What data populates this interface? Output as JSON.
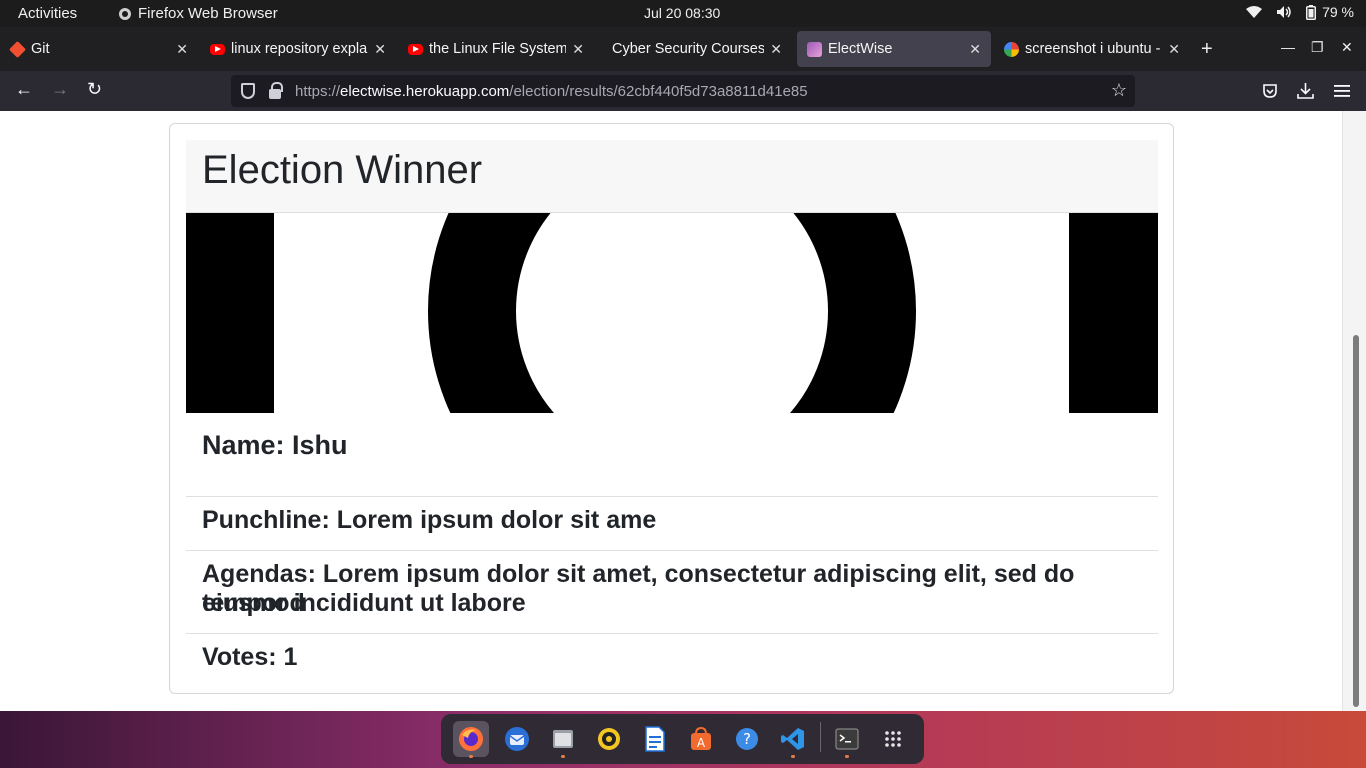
{
  "topbar": {
    "activities": "Activities",
    "app_name": "Firefox Web Browser",
    "clock": "Jul 20  08:30",
    "battery": "79 %"
  },
  "tabs": [
    {
      "title": "Git",
      "icon": "git-icon"
    },
    {
      "title": "linux repository expla",
      "icon": "youtube-icon"
    },
    {
      "title": "the Linux File System",
      "icon": "youtube-icon"
    },
    {
      "title": "Cyber Security Courses :",
      "icon": "none"
    },
    {
      "title": "ElectWise",
      "icon": "electwise-icon",
      "active": true
    },
    {
      "title": "screenshot i ubuntu -",
      "icon": "google-icon"
    }
  ],
  "navbar": {
    "url_prefix": "https://",
    "url_host": "electwise.herokuapp.com",
    "url_path": "/election/results/62cbf440f5d73a8811d41e85"
  },
  "page": {
    "title": "Election Winner",
    "name": "Name: Ishu",
    "punchline": "Punchline: Lorem ipsum dolor sit ame",
    "agendas_line1": "Agendas: Lorem ipsum dolor sit amet, consectetur adipiscing elit, sed do eiusmod",
    "agendas_line2": "tempor incididunt ut labore",
    "votes": "Votes: 1"
  },
  "dock": [
    "firefox-icon",
    "thunderbird-icon",
    "files-icon",
    "rhythmbox-icon",
    "writer-icon",
    "software-icon",
    "help-icon",
    "vscode-icon",
    "terminal-icon",
    "app-grid-icon"
  ],
  "colors": {
    "topbar": "#1c1c1c",
    "tabstrip": "#202023",
    "active_tab": "#42414d",
    "navbar": "#2b2a33",
    "urlbar": "#1c1b22",
    "text": "#212529"
  }
}
